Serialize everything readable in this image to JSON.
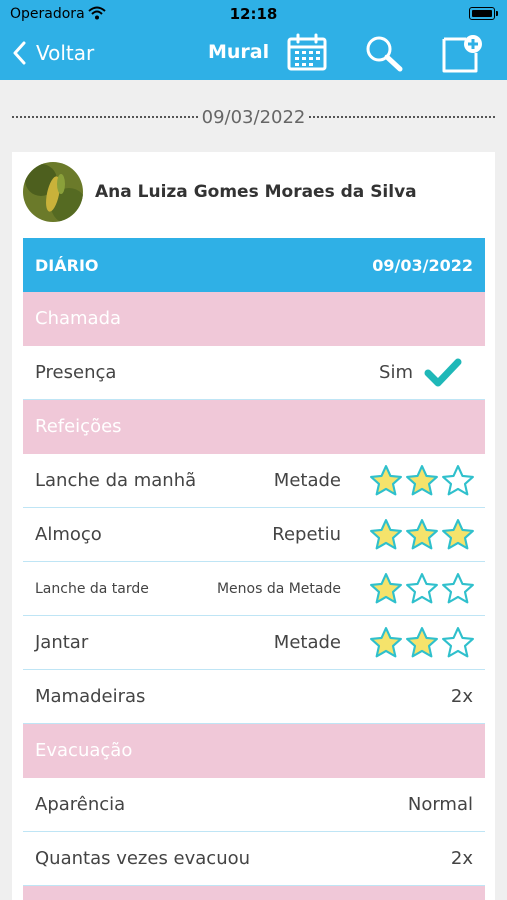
{
  "status_bar": {
    "carrier": "Operadora",
    "time": "12:18"
  },
  "nav": {
    "back_label": "Voltar",
    "title": "Mural"
  },
  "date_separator": "09/03/2022",
  "post": {
    "author": "Ana Luiza Gomes Moraes da Silva",
    "diary": {
      "label": "DIÁRIO",
      "date": "09/03/2022"
    },
    "sections": {
      "chamada": "Chamada",
      "refeicoes": "Refeições",
      "evacuacao": "Evacuação"
    },
    "presenca": {
      "label": "Presença",
      "value": "Sim"
    },
    "meals": [
      {
        "label": "Lanche da manhã",
        "value": "Metade",
        "rating": 2,
        "max": 3
      },
      {
        "label": "Almoço",
        "value": "Repetiu",
        "rating": 3,
        "max": 3
      },
      {
        "label": "Lanche da tarde",
        "value": "Menos da Metade",
        "rating": 1,
        "max": 3
      },
      {
        "label": "Jantar",
        "value": "Metade",
        "rating": 2,
        "max": 3
      }
    ],
    "mamadeiras": {
      "label": "Mamadeiras",
      "value": "2x"
    },
    "aparencia": {
      "label": "Aparência",
      "value": "Normal"
    },
    "quantas": {
      "label": "Quantas vezes evacuou",
      "value": "2x"
    }
  },
  "colors": {
    "primary": "#2fb0e6",
    "section_pink": "#f0c8d8",
    "star_fill": "#f5e36b",
    "star_stroke": "#2fc0cc",
    "check": "#1fb8b8"
  }
}
